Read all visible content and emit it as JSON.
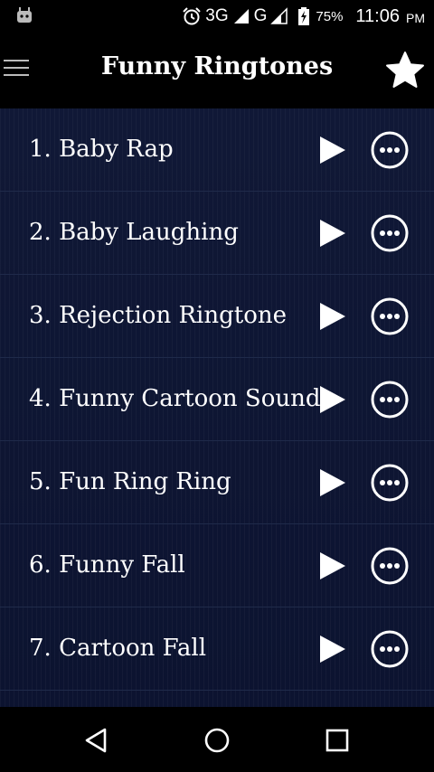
{
  "status_bar": {
    "network_1": "3G",
    "network_2": "G",
    "battery_percent": "75%",
    "time": "11:06",
    "ampm": "PM"
  },
  "header": {
    "title": "Funny Ringtones"
  },
  "ringtones": [
    {
      "label": "1. Baby Rap"
    },
    {
      "label": "2. Baby Laughing"
    },
    {
      "label": "3. Rejection Ringtone"
    },
    {
      "label": "4. Funny Cartoon Sound"
    },
    {
      "label": "5. Fun Ring Ring"
    },
    {
      "label": "6. Funny Fall"
    },
    {
      "label": "7. Cartoon Fall"
    }
  ],
  "icons": {
    "menu": "hamburger-menu-icon",
    "favorite": "star-icon",
    "play": "play-icon",
    "more": "more-options-icon",
    "nav_back": "back-triangle-icon",
    "nav_home": "home-circle-icon",
    "nav_recent": "recent-square-icon"
  },
  "colors": {
    "list_background": "#0e1530",
    "divider": "#1f2a4a",
    "text": "#ffffff"
  }
}
